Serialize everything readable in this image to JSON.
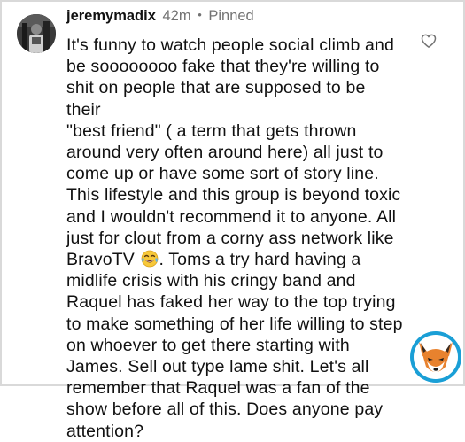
{
  "comment": {
    "username": "jeremymadix",
    "time_ago": "42m",
    "separator": "•",
    "pinned_label": "Pinned",
    "text_before_emoji": "It's funny to watch people social climb and\nbe soooooooo fake that they're willing to\nshit on people that are supposed to be their\n\"best friend\" ( a term that gets thrown\naround very often around here) all just to\ncome up or have some sort of story line.\nThis lifestyle and this group is beyond toxic\nand I wouldn't recommend it to anyone. All\njust for clout from a corny ass network like\nBravoTV",
    "emoji_name": "laughing-tears",
    "text_after_emoji": ". Toms  a try hard having a\nmidlife crisis with his cringy band and\nRaquel has faked her way to the top trying\nto make something of her life willing to step\non whoever to get there starting with\nJames. Sell out type lame shit. Let's all\nremember that Raquel was a fan of the\nshow before all of this. Does anyone pay\nattention?"
  },
  "icons": {
    "like": "heart-outline-icon",
    "watermark_logo": "fox-logo"
  },
  "colors": {
    "text": "#111111",
    "meta": "#737373",
    "fox_ring": "#1a9fd6",
    "fox_orange": "#e8822e"
  }
}
